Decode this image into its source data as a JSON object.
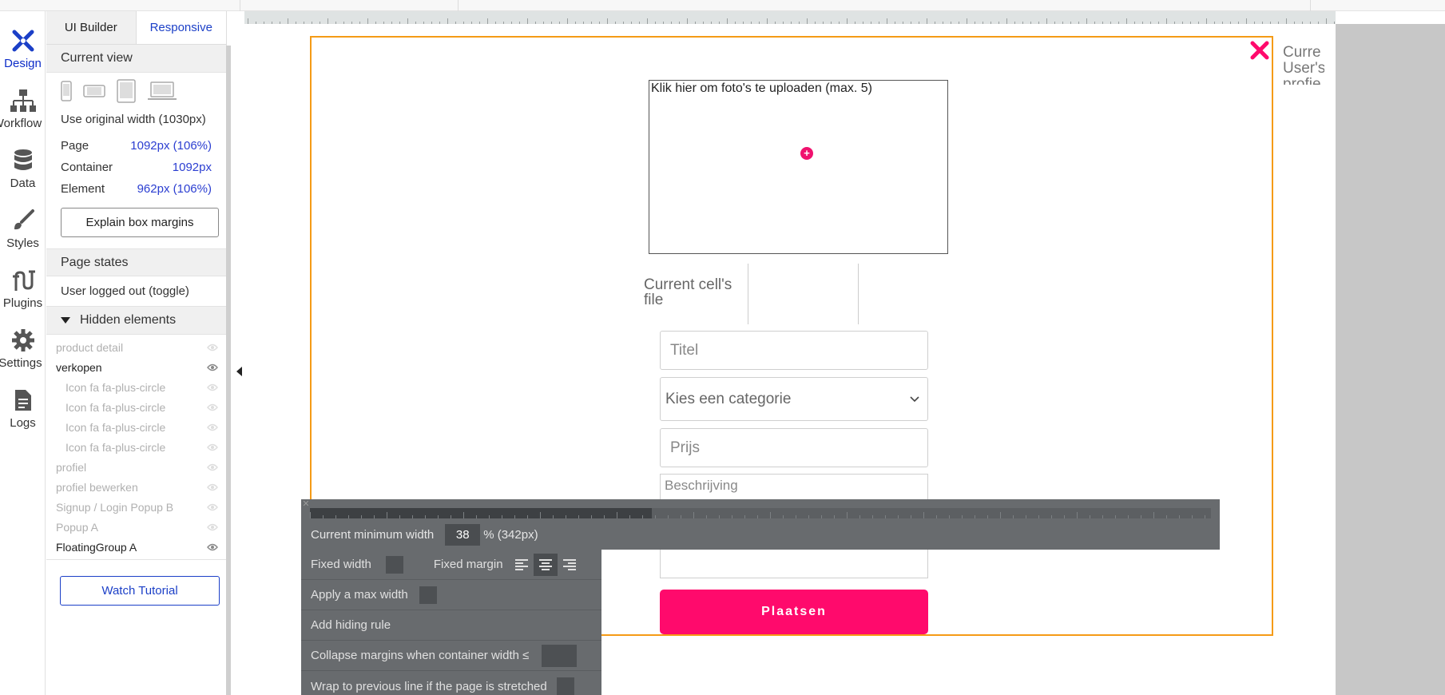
{
  "rail": {
    "design": "Design",
    "workflow": "Workflow",
    "data": "Data",
    "styles": "Styles",
    "plugins": "Plugins",
    "settings": "Settings",
    "logs": "Logs"
  },
  "tabs": {
    "ui_builder": "UI Builder",
    "responsive": "Responsive"
  },
  "current_view": {
    "heading": "Current view",
    "original_width": "Use original width (1030px)",
    "page_label": "Page",
    "page_value": "1092px (106%)",
    "container_label": "Container",
    "container_value": "1092px",
    "element_label": "Element",
    "element_value": "962px (106%)",
    "explain_button": "Explain box margins"
  },
  "page_states": {
    "heading": "Page states",
    "state": "User logged out (toggle)"
  },
  "hidden": {
    "heading": "Hidden elements",
    "items": [
      "product detail",
      "verkopen",
      "Icon fa fa-plus-circle",
      "Icon fa fa-plus-circle",
      "Icon fa fa-plus-circle",
      "Icon fa fa-plus-circle",
      "profiel",
      "profiel bewerken",
      "Signup / Login Popup B",
      "Popup A",
      "FloatingGroup A"
    ]
  },
  "tutorial_button": "Watch Tutorial",
  "canvas": {
    "side_text_1": "Curre",
    "side_text_2": "User's",
    "side_text_3": "profie",
    "uploader_caption": "Klik hier om foto's te uploaden (max. 5)",
    "cell_file": "Current cell's file",
    "title_placeholder": "Titel",
    "category_placeholder": "Kies een categorie",
    "price_placeholder": "Prijs",
    "description_placeholder": "Beschrijving",
    "submit": "Plaatsen"
  },
  "responsive": {
    "min_width_label": "Current minimum width",
    "min_width_value": "38",
    "min_width_suffix": "% (342px)",
    "fixed_width": "Fixed width",
    "fixed_margin": "Fixed margin",
    "max_width": "Apply a max width",
    "hiding_rule": "Add hiding rule",
    "collapse_margins": "Collapse margins when container width ≤",
    "wrap": "Wrap to previous line if the page is stretched"
  },
  "colors": {
    "accent_blue": "#1b3fc7",
    "brand_pink": "#ff0a6c",
    "popup_border": "#f59b16"
  }
}
